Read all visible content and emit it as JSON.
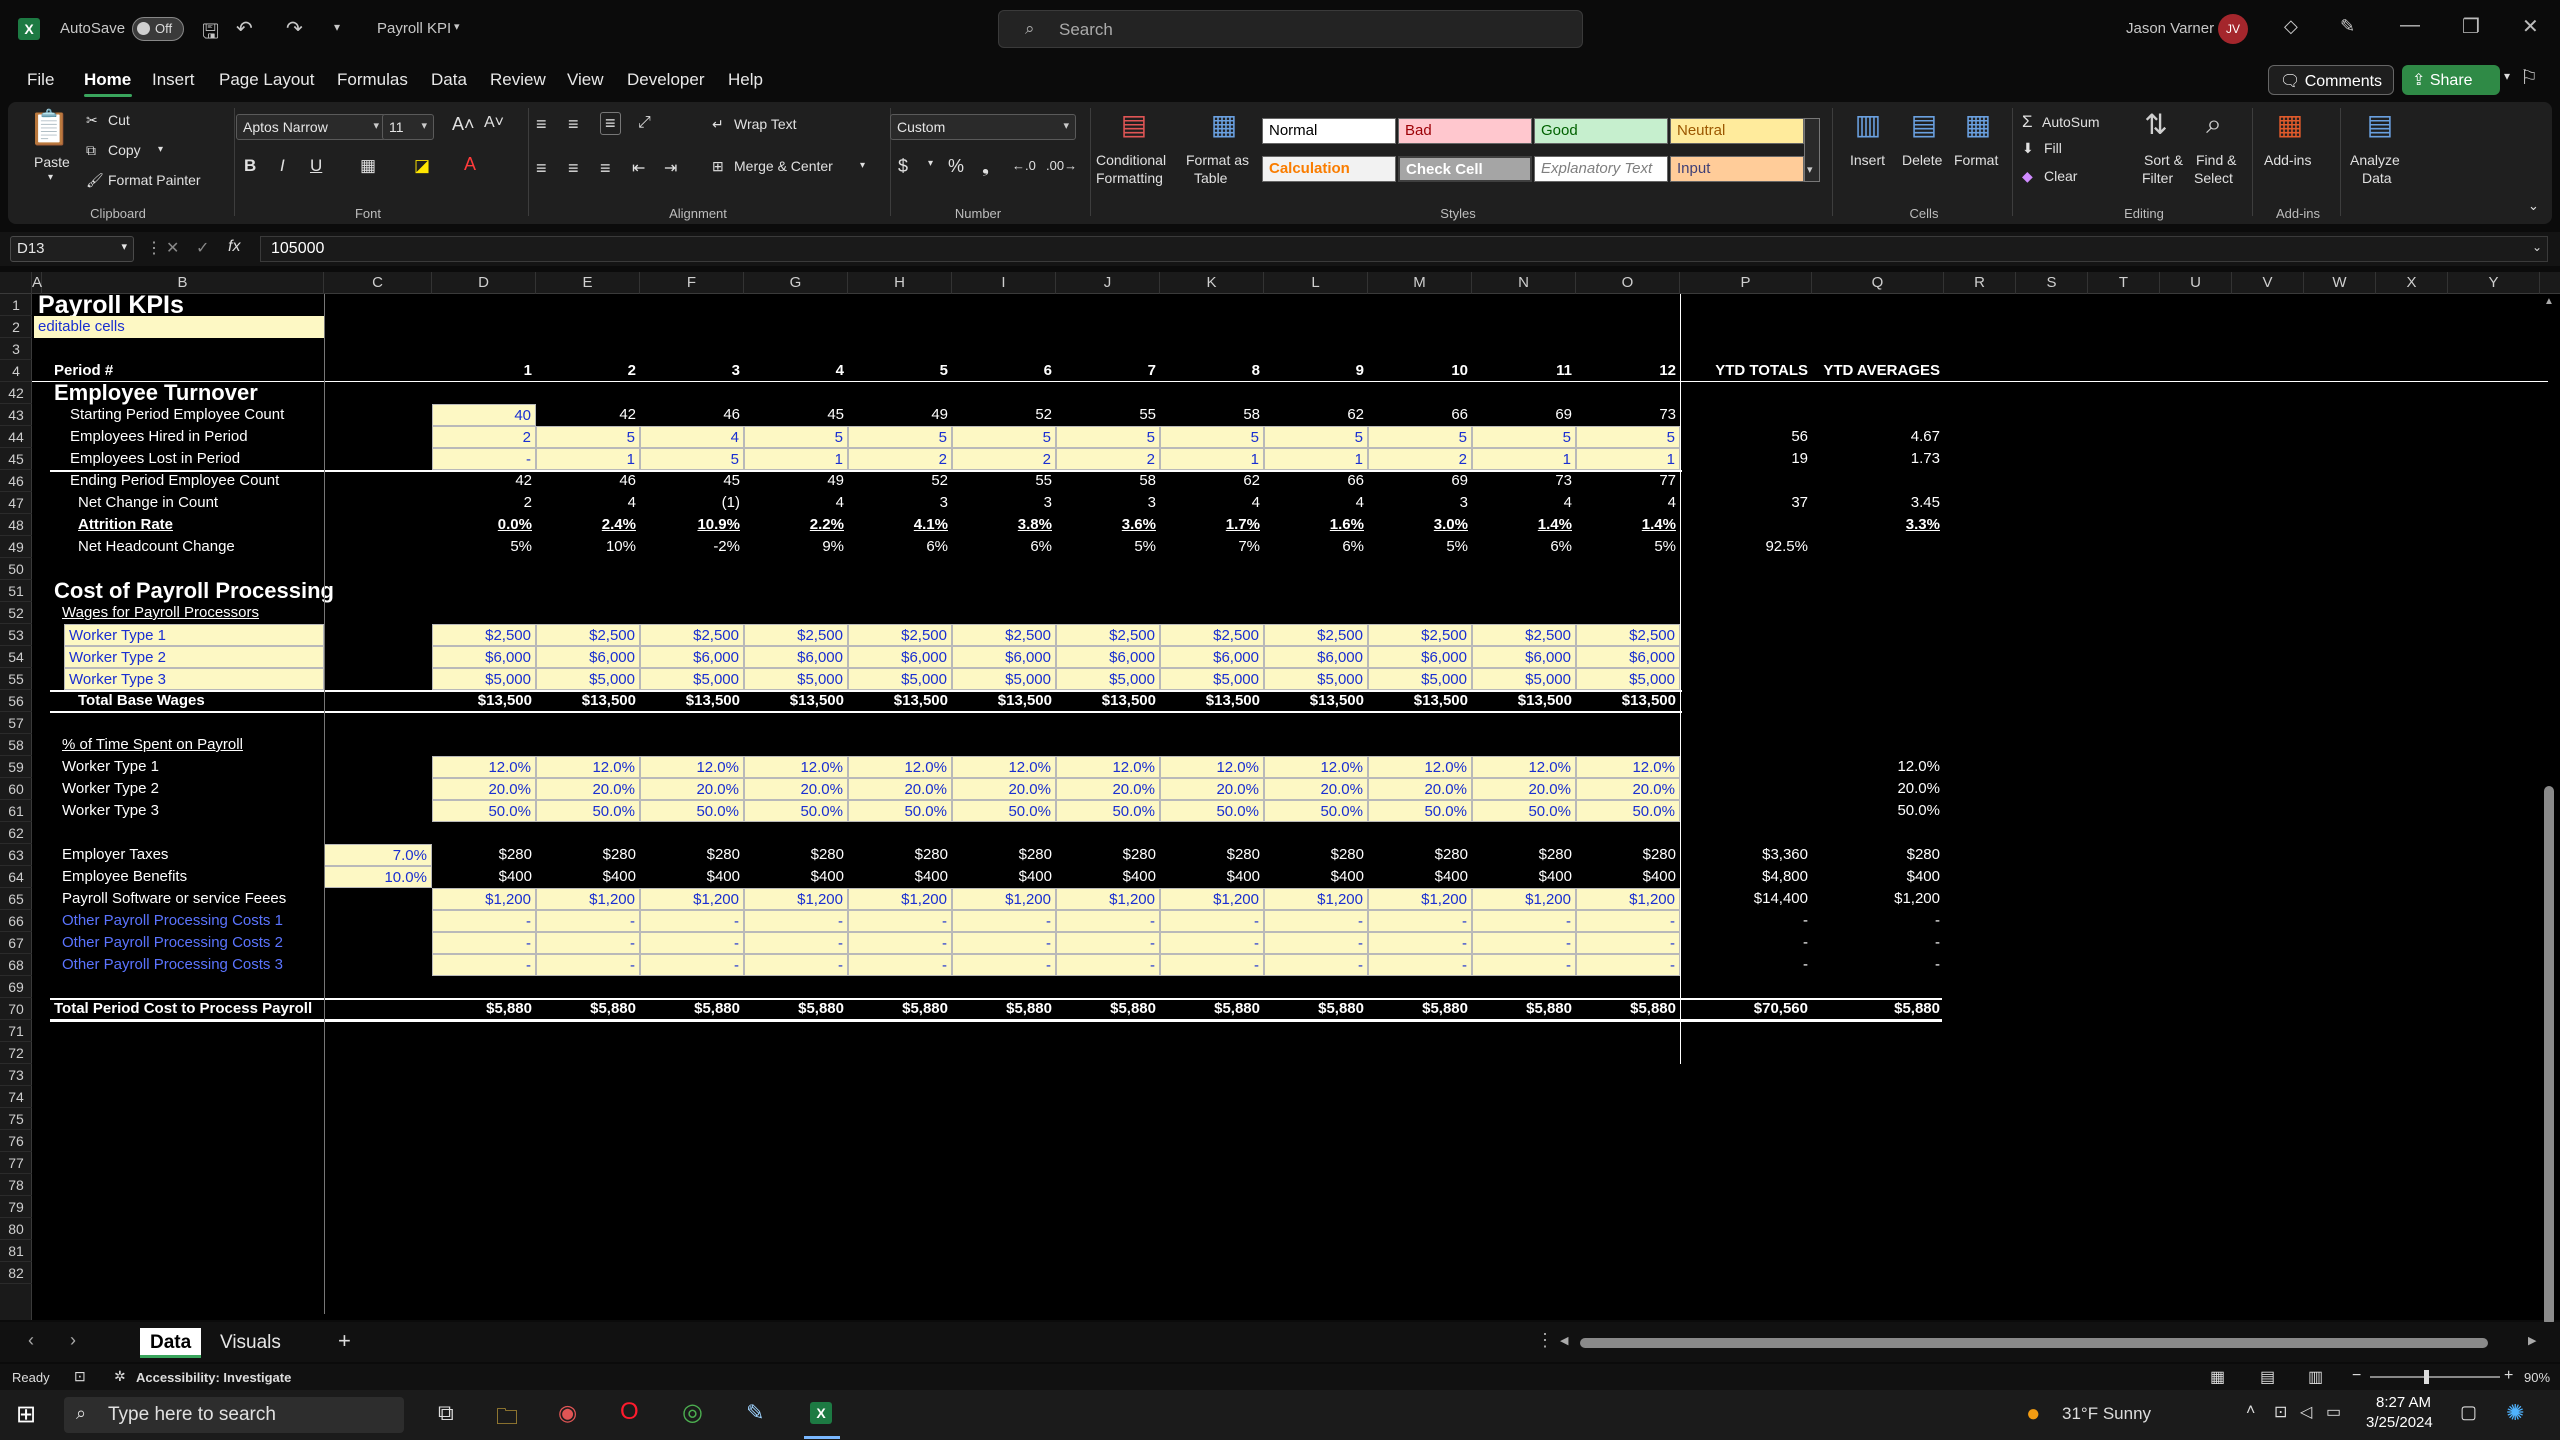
{
  "titlebar": {
    "autosave_label": "AutoSave",
    "autosave_state": "Off",
    "filename": "Payroll KPI",
    "search_placeholder": "Search",
    "user_name": "Jason Varner",
    "user_initials": "JV"
  },
  "menu": {
    "items": [
      "File",
      "Home",
      "Insert",
      "Page Layout",
      "Formulas",
      "Data",
      "Review",
      "View",
      "Developer",
      "Help"
    ],
    "comments": "Comments",
    "share": "Share"
  },
  "ribbon": {
    "paste": "Paste",
    "cut": "Cut",
    "copy": "Copy",
    "format_painter": "Format Painter",
    "clipboard": "Clipboard",
    "font_name": "Aptos Narrow",
    "font_size": "11",
    "font": "Font",
    "wrap_text": "Wrap Text",
    "merge_center": "Merge & Center",
    "alignment": "Alignment",
    "number_format": "Custom",
    "number": "Number",
    "conditional_formatting_1": "Conditional",
    "conditional_formatting_2": "Formatting",
    "format_as_table_1": "Format as",
    "format_as_table_2": "Table",
    "styles": "Styles",
    "style_normal": "Normal",
    "style_bad": "Bad",
    "style_good": "Good",
    "style_neutral": "Neutral",
    "style_calculation": "Calculation",
    "style_check_cell": "Check Cell",
    "style_explanatory": "Explanatory Text",
    "style_input": "Input",
    "insert": "Insert",
    "delete": "Delete",
    "format": "Format",
    "cells": "Cells",
    "autosum": "AutoSum",
    "fill": "Fill",
    "clear": "Clear",
    "sort_filter_1": "Sort &",
    "sort_filter_2": "Filter",
    "find_select_1": "Find &",
    "find_select_2": "Select",
    "editing": "Editing",
    "addins": "Add-ins",
    "addins_group": "Add-ins",
    "analyze_1": "Analyze",
    "analyze_2": "Data"
  },
  "formula_bar": {
    "name_box": "D13",
    "fx": "fx",
    "value": "105000"
  },
  "columns": [
    "A",
    "B",
    "C",
    "D",
    "E",
    "F",
    "G",
    "H",
    "I",
    "J",
    "K",
    "L",
    "M",
    "N",
    "O",
    "P",
    "Q",
    "R",
    "S",
    "T",
    "U",
    "V",
    "W",
    "X",
    "Y"
  ],
  "rows": [
    "1",
    "2",
    "3",
    "4",
    "42",
    "43",
    "44",
    "45",
    "46",
    "47",
    "48",
    "49",
    "50",
    "51",
    "52",
    "53",
    "54",
    "55",
    "56",
    "57",
    "58",
    "59",
    "60",
    "61",
    "62",
    "63",
    "64",
    "65",
    "66",
    "67",
    "68",
    "69",
    "70",
    "71",
    "72",
    "73",
    "74",
    "75",
    "76",
    "77",
    "78",
    "79",
    "80",
    "81",
    "82"
  ],
  "sheet": {
    "title": "Payroll KPIs",
    "editable_note": "editable cells",
    "period_label": "Period #",
    "periods": [
      "1",
      "2",
      "3",
      "4",
      "5",
      "6",
      "7",
      "8",
      "9",
      "10",
      "11",
      "12"
    ],
    "ytd_totals": "YTD TOTALS",
    "ytd_averages": "YTD AVERAGES",
    "turnover_title": "Employee Turnover",
    "turnover_rows": [
      {
        "label": "Starting Period Employee Count",
        "values": [
          "40",
          "42",
          "46",
          "45",
          "49",
          "52",
          "55",
          "58",
          "62",
          "66",
          "69",
          "73"
        ],
        "total": "",
        "avg": ""
      },
      {
        "label": "Employees Hired in Period",
        "values": [
          "2",
          "5",
          "4",
          "5",
          "5",
          "5",
          "5",
          "5",
          "5",
          "5",
          "5",
          "5"
        ],
        "total": "56",
        "avg": "4.67"
      },
      {
        "label": "Employees Lost in Period",
        "values": [
          "-",
          "1",
          "5",
          "1",
          "2",
          "2",
          "2",
          "1",
          "1",
          "2",
          "1",
          "1"
        ],
        "total": "19",
        "avg": "1.73"
      },
      {
        "label": "Ending Period Employee Count",
        "values": [
          "42",
          "46",
          "45",
          "49",
          "52",
          "55",
          "58",
          "62",
          "66",
          "69",
          "73",
          "77"
        ],
        "total": "",
        "avg": ""
      },
      {
        "label": "Net Change in Count",
        "values": [
          "2",
          "4",
          "(1)",
          "4",
          "3",
          "3",
          "3",
          "4",
          "4",
          "3",
          "4",
          "4"
        ],
        "total": "37",
        "avg": "3.45"
      },
      {
        "label": "Attrition Rate",
        "values": [
          "0.0%",
          "2.4%",
          "10.9%",
          "2.2%",
          "4.1%",
          "3.8%",
          "3.6%",
          "1.7%",
          "1.6%",
          "3.0%",
          "1.4%",
          "1.4%"
        ],
        "total": "",
        "avg": "3.3%"
      },
      {
        "label": "Net Headcount Change",
        "values": [
          "5%",
          "10%",
          "-2%",
          "9%",
          "6%",
          "6%",
          "5%",
          "7%",
          "6%",
          "5%",
          "6%",
          "5%"
        ],
        "total": "92.5%",
        "avg": ""
      }
    ],
    "cost_title": "Cost of Payroll Processing",
    "wages_header": "Wages for Payroll Processors",
    "wage_rows": [
      {
        "label": "Worker Type 1",
        "values": [
          "$2,500",
          "$2,500",
          "$2,500",
          "$2,500",
          "$2,500",
          "$2,500",
          "$2,500",
          "$2,500",
          "$2,500",
          "$2,500",
          "$2,500",
          "$2,500"
        ]
      },
      {
        "label": "Worker Type 2",
        "values": [
          "$6,000",
          "$6,000",
          "$6,000",
          "$6,000",
          "$6,000",
          "$6,000",
          "$6,000",
          "$6,000",
          "$6,000",
          "$6,000",
          "$6,000",
          "$6,000"
        ]
      },
      {
        "label": "Worker Type 3",
        "values": [
          "$5,000",
          "$5,000",
          "$5,000",
          "$5,000",
          "$5,000",
          "$5,000",
          "$5,000",
          "$5,000",
          "$5,000",
          "$5,000",
          "$5,000",
          "$5,000"
        ]
      }
    ],
    "total_wages": {
      "label": "Total Base Wages",
      "values": [
        "$13,500",
        "$13,500",
        "$13,500",
        "$13,500",
        "$13,500",
        "$13,500",
        "$13,500",
        "$13,500",
        "$13,500",
        "$13,500",
        "$13,500",
        "$13,500"
      ]
    },
    "time_header": "% of Time Spent on Payroll",
    "time_rows": [
      {
        "label": "Worker Type 1",
        "values": [
          "12.0%",
          "12.0%",
          "12.0%",
          "12.0%",
          "12.0%",
          "12.0%",
          "12.0%",
          "12.0%",
          "12.0%",
          "12.0%",
          "12.0%",
          "12.0%"
        ],
        "avg": "12.0%"
      },
      {
        "label": "Worker Type 2",
        "values": [
          "20.0%",
          "20.0%",
          "20.0%",
          "20.0%",
          "20.0%",
          "20.0%",
          "20.0%",
          "20.0%",
          "20.0%",
          "20.0%",
          "20.0%",
          "20.0%"
        ],
        "avg": "20.0%"
      },
      {
        "label": "Worker Type 3",
        "values": [
          "50.0%",
          "50.0%",
          "50.0%",
          "50.0%",
          "50.0%",
          "50.0%",
          "50.0%",
          "50.0%",
          "50.0%",
          "50.0%",
          "50.0%",
          "50.0%"
        ],
        "avg": "50.0%"
      }
    ],
    "cost_rows": [
      {
        "label": "Employer Taxes",
        "rate": "7.0%",
        "values": [
          "$280",
          "$280",
          "$280",
          "$280",
          "$280",
          "$280",
          "$280",
          "$280",
          "$280",
          "$280",
          "$280",
          "$280"
        ],
        "total": "$3,360",
        "avg": "$280",
        "input": false
      },
      {
        "label": "Employee Benefits",
        "rate": "10.0%",
        "values": [
          "$400",
          "$400",
          "$400",
          "$400",
          "$400",
          "$400",
          "$400",
          "$400",
          "$400",
          "$400",
          "$400",
          "$400"
        ],
        "total": "$4,800",
        "avg": "$400",
        "input": false
      },
      {
        "label": "Payroll Software or service Feees",
        "rate": "",
        "values": [
          "$1,200",
          "$1,200",
          "$1,200",
          "$1,200",
          "$1,200",
          "$1,200",
          "$1,200",
          "$1,200",
          "$1,200",
          "$1,200",
          "$1,200",
          "$1,200"
        ],
        "total": "$14,400",
        "avg": "$1,200",
        "input": true
      },
      {
        "label": "Other Payroll Processing Costs 1",
        "rate": "",
        "values": [
          "-",
          "-",
          "-",
          "-",
          "-",
          "-",
          "-",
          "-",
          "-",
          "-",
          "-",
          "-"
        ],
        "total": "-",
        "avg": "-",
        "input": true
      },
      {
        "label": "Other Payroll Processing Costs 2",
        "rate": "",
        "values": [
          "-",
          "-",
          "-",
          "-",
          "-",
          "-",
          "-",
          "-",
          "-",
          "-",
          "-",
          "-"
        ],
        "total": "-",
        "avg": "-",
        "input": true
      },
      {
        "label": "Other Payroll Processing Costs 3",
        "rate": "",
        "values": [
          "-",
          "-",
          "-",
          "-",
          "-",
          "-",
          "-",
          "-",
          "-",
          "-",
          "-",
          "-"
        ],
        "total": "-",
        "avg": "-",
        "input": true
      }
    ],
    "total_cost": {
      "label": "Total Period Cost to Process Payroll",
      "values": [
        "$5,880",
        "$5,880",
        "$5,880",
        "$5,880",
        "$5,880",
        "$5,880",
        "$5,880",
        "$5,880",
        "$5,880",
        "$5,880",
        "$5,880",
        "$5,880"
      ],
      "total": "$70,560",
      "avg": "$5,880"
    }
  },
  "tabs": [
    "Data",
    "Visuals"
  ],
  "status": {
    "ready": "Ready",
    "accessibility": "Accessibility: Investigate",
    "zoom": "90%"
  },
  "taskbar": {
    "search_placeholder": "Type here to search",
    "weather": "31°F  Sunny",
    "time": "8:27 AM",
    "date": "3/25/2024"
  },
  "colors": {
    "input_fill": "#fdf8c4",
    "input_text": "#1a2fd1",
    "accent": "#3aa55d"
  }
}
